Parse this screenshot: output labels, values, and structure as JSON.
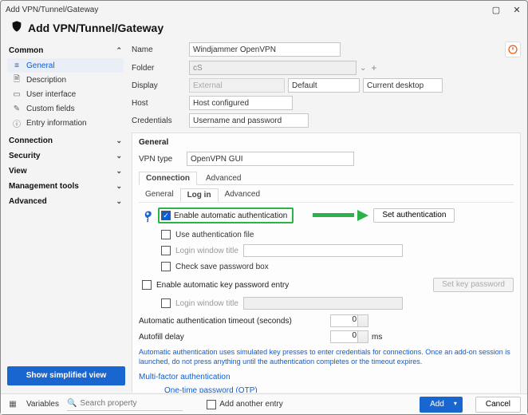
{
  "window": {
    "title": "Add VPN/Tunnel/Gateway"
  },
  "header": {
    "title": "Add VPN/Tunnel/Gateway"
  },
  "sidebar": {
    "sections": [
      {
        "label": "Common",
        "expanded": true,
        "items": [
          {
            "label": "General",
            "icon": "general",
            "selected": true
          },
          {
            "label": "Description",
            "icon": "description"
          },
          {
            "label": "User interface",
            "icon": "ui"
          },
          {
            "label": "Custom fields",
            "icon": "custom"
          },
          {
            "label": "Entry information",
            "icon": "info"
          }
        ]
      },
      {
        "label": "Connection",
        "expanded": false
      },
      {
        "label": "Security",
        "expanded": false
      },
      {
        "label": "View",
        "expanded": false
      },
      {
        "label": "Management tools",
        "expanded": false
      },
      {
        "label": "Advanced",
        "expanded": false
      }
    ],
    "simplified_btn": "Show simplified view"
  },
  "form": {
    "name_label": "Name",
    "name_value": "Windjammer OpenVPN",
    "folder_label": "Folder",
    "folder_value": "cS",
    "display_label": "Display",
    "display_value": "External",
    "display_opt2": "Default",
    "display_opt3": "Current desktop",
    "host_label": "Host",
    "host_value": "Host configured",
    "cred_label": "Credentials",
    "cred_value": "Username and password"
  },
  "panel": {
    "title": "General",
    "vpn_type_label": "VPN type",
    "vpn_type_value": "OpenVPN GUI",
    "tabs": {
      "connection": "Connection",
      "advanced": "Advanced"
    },
    "subtabs": {
      "general": "General",
      "login": "Log in",
      "advanced": "Advanced"
    },
    "login": {
      "enable_auth": "Enable automatic authentication",
      "set_auth_btn": "Set authentication",
      "use_auth_file": "Use authentication file",
      "login_window_title": "Login window title",
      "check_save_pw": "Check save password box",
      "enable_key_pw": "Enable automatic key password entry",
      "set_key_pw_btn": "Set key password",
      "auto_timeout_label": "Automatic authentication timeout (seconds)",
      "auto_timeout_value": "0",
      "autofill_label": "Autofill delay",
      "autofill_value": "0",
      "autofill_unit": "ms",
      "note": "Automatic authentication uses simulated key presses to enter credentials for connections. Once an add-on session is launched, do not press anything until the authentication completes or the timeout expires."
    },
    "mfa": {
      "header": "Multi-factor authentication",
      "otp": "One-time password (OTP)"
    }
  },
  "footer": {
    "variables": "Variables",
    "search_placeholder": "Search property",
    "add_another": "Add another entry",
    "add": "Add",
    "cancel": "Cancel"
  }
}
